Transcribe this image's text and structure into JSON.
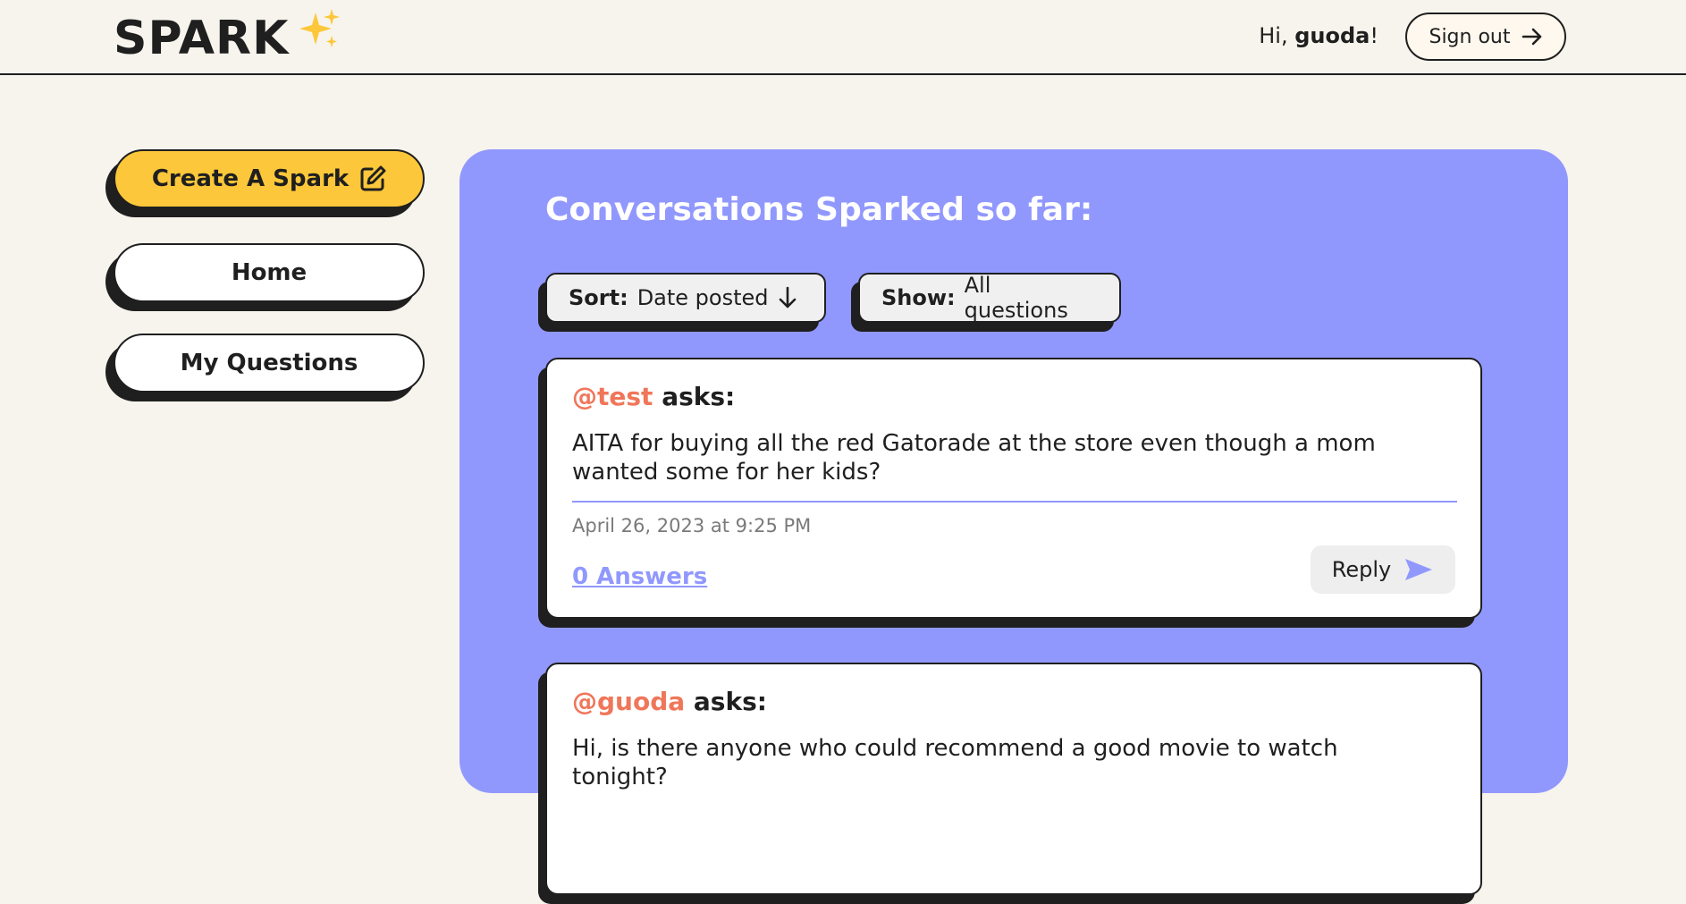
{
  "header": {
    "logo_text": "SPARK",
    "logo_icon": "sparkles-icon",
    "greeting_prefix": "Hi, ",
    "username": "guoda",
    "greeting_suffix": "!",
    "signout_label": "Sign out"
  },
  "sidebar": {
    "items": [
      {
        "label": "Create A Spark",
        "icon": "edit-icon"
      },
      {
        "label": "Home"
      },
      {
        "label": "My Questions"
      }
    ]
  },
  "main": {
    "title": "Conversations Sparked so far:",
    "sort": {
      "label": "Sort:",
      "value": "Date posted",
      "icon": "arrow-down-icon"
    },
    "show": {
      "label": "Show:",
      "value": "All questions"
    },
    "questions": [
      {
        "user": "@test",
        "asks": "asks:",
        "text": "AITA for buying all the red Gatorade at the store even though a mom wanted some for her kids?",
        "date": "April 26, 2023 at 9:25 PM",
        "answers": "0 Answers",
        "reply_label": "Reply"
      },
      {
        "user": "@guoda",
        "asks": "asks:",
        "text": "Hi, is there anyone who could recommend a good movie to watch tonight?"
      }
    ]
  },
  "colors": {
    "background": "#f7f4ed",
    "accent_purple": "#9198fd",
    "accent_yellow": "#fcc73a",
    "username_orange": "#f0765a"
  }
}
